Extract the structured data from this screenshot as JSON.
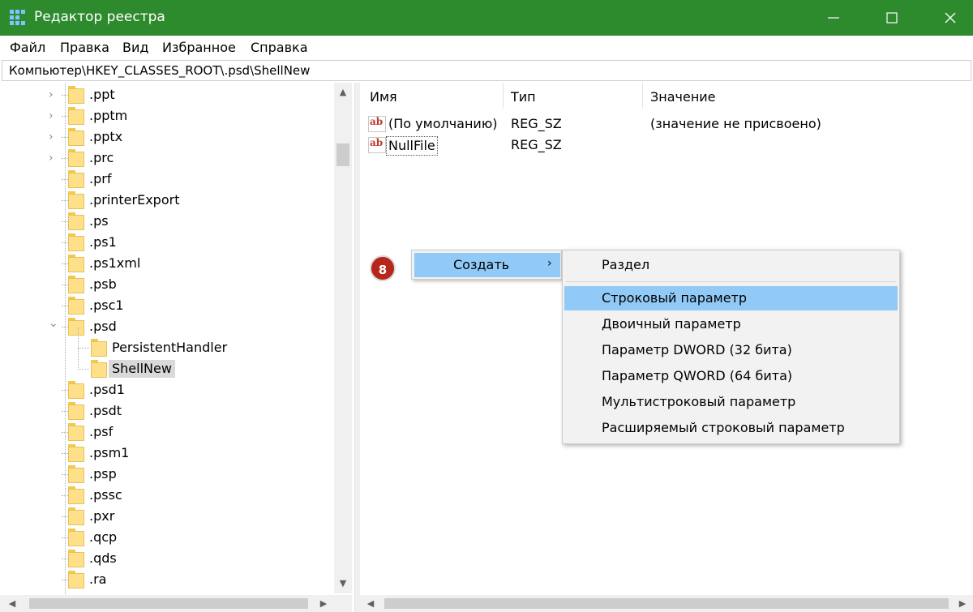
{
  "window": {
    "title": "Редактор реестра",
    "controls": {
      "minimize": "minimize-icon",
      "maximize": "maximize-icon",
      "close": "close-icon"
    }
  },
  "menubar": {
    "items": [
      {
        "label": "Файл"
      },
      {
        "label": "Правка"
      },
      {
        "label": "Вид"
      },
      {
        "label": "Избранное"
      },
      {
        "label": "Справка"
      }
    ]
  },
  "address": {
    "path": "Компьютер\\HKEY_CLASSES_ROOT\\.psd\\ShellNew"
  },
  "tree": {
    "nodes": [
      {
        "label": ".ppt",
        "expander": "collapsed"
      },
      {
        "label": ".pptm",
        "expander": "collapsed"
      },
      {
        "label": ".pptx",
        "expander": "collapsed"
      },
      {
        "label": ".prc",
        "expander": "collapsed"
      },
      {
        "label": ".prf",
        "expander": "none"
      },
      {
        "label": ".printerExport",
        "expander": "none"
      },
      {
        "label": ".ps",
        "expander": "none"
      },
      {
        "label": ".ps1",
        "expander": "none"
      },
      {
        "label": ".ps1xml",
        "expander": "none"
      },
      {
        "label": ".psb",
        "expander": "none"
      },
      {
        "label": ".psc1",
        "expander": "none"
      },
      {
        "label": ".psd",
        "expander": "expanded"
      },
      {
        "label": "PersistentHandler",
        "expander": "child"
      },
      {
        "label": "ShellNew",
        "expander": "child-selected"
      },
      {
        "label": ".psd1",
        "expander": "none"
      },
      {
        "label": ".psdt",
        "expander": "none"
      },
      {
        "label": ".psf",
        "expander": "none"
      },
      {
        "label": ".psm1",
        "expander": "none"
      },
      {
        "label": ".psp",
        "expander": "none"
      },
      {
        "label": ".pssc",
        "expander": "none"
      },
      {
        "label": ".pxr",
        "expander": "none"
      },
      {
        "label": ".qcp",
        "expander": "none"
      },
      {
        "label": ".qds",
        "expander": "none"
      },
      {
        "label": ".ra",
        "expander": "none"
      }
    ]
  },
  "list": {
    "columns": {
      "name": "Имя",
      "type": "Тип",
      "value": "Значение"
    },
    "rows": [
      {
        "name": "(По умолчанию)",
        "type": "REG_SZ",
        "value": "(значение не присвоено)"
      },
      {
        "name": "NullFile",
        "type": "REG_SZ",
        "value": ""
      }
    ]
  },
  "badge": {
    "text": "8",
    "color": "#b7261a"
  },
  "context_menu": {
    "item": "Создать",
    "arrow": "›",
    "highlight_color": "#91c9f7"
  },
  "submenu": {
    "items": [
      {
        "label": "Раздел"
      },
      {
        "label": "Строковый параметр"
      },
      {
        "label": "Двоичный параметр"
      },
      {
        "label": "Параметр DWORD (32 бита)"
      },
      {
        "label": "Параметр QWORD (64 бита)"
      },
      {
        "label": "Мультистроковый параметр"
      },
      {
        "label": "Расширяемый строковый параметр"
      }
    ]
  },
  "colors": {
    "titlebar": "#2d8a2d",
    "selection": "#d9d9d9",
    "menu_highlight": "#91c9f7"
  }
}
